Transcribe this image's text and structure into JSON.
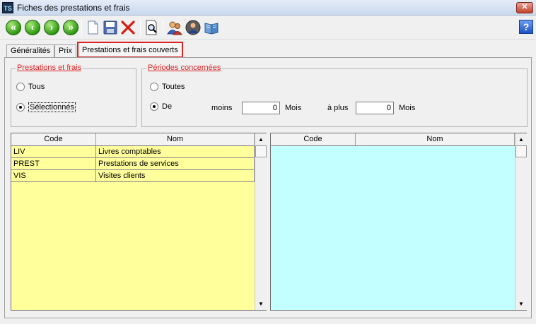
{
  "window": {
    "title": "Fiches des prestations et frais",
    "app_icon_text": "TS",
    "close_label": "✕"
  },
  "toolbar": {
    "nav_first": "«",
    "nav_prev": "‹",
    "nav_next": "›",
    "nav_last": "»",
    "help_label": "?"
  },
  "tabs": [
    {
      "label": "Généralités"
    },
    {
      "label": "Prix"
    },
    {
      "label": "Prestations et frais couverts"
    }
  ],
  "prestations_group": {
    "legend": "Prestations et frais",
    "option_all": "Tous",
    "option_selected": "Sélectionnés",
    "selected": "option_selected"
  },
  "periodes_group": {
    "legend": "Périodes concernées",
    "option_all": "Toutes",
    "option_range": "De",
    "selected": "option_range",
    "moins_label": "moins",
    "moins_value": "0",
    "mois_label_1": "Mois",
    "plus_label": "à plus",
    "plus_value": "0",
    "mois_label_2": "Mois"
  },
  "left_grid": {
    "columns": [
      "Code",
      "Nom"
    ],
    "rows": [
      [
        "LIV",
        "Livres comptables"
      ],
      [
        "PREST",
        "Prestations de services"
      ],
      [
        "VIS",
        "Visites clients"
      ]
    ]
  },
  "right_grid": {
    "columns": [
      "Code",
      "Nom"
    ],
    "rows": []
  },
  "colors": {
    "left_grid_bg": "#ffff9c",
    "right_grid_bg": "#c4ffff",
    "legend": "#d22222",
    "active_tab_border": "#d22222"
  }
}
